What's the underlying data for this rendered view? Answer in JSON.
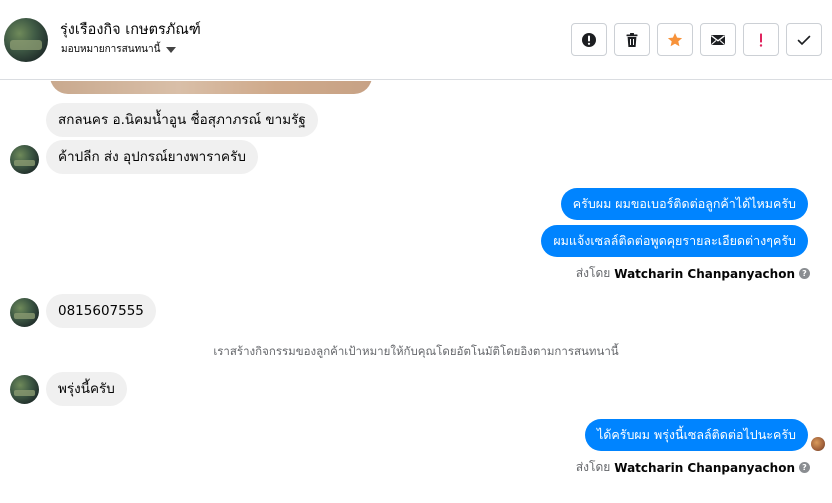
{
  "header": {
    "contact_name": "รุ่งเรืองกิจ เกษตรภัณฑ์",
    "assign_label": "มอบหมายการสนทนานี้",
    "toolbar": [
      {
        "name": "spam-button",
        "icon": "alert-circle-icon"
      },
      {
        "name": "delete-button",
        "icon": "trash-icon"
      },
      {
        "name": "star-button",
        "icon": "star-icon"
      },
      {
        "name": "mark-unread-button",
        "icon": "envelope-icon"
      },
      {
        "name": "flag-button",
        "icon": "exclamation-icon"
      },
      {
        "name": "mark-done-button",
        "icon": "checkmark-icon"
      }
    ],
    "colors": {
      "star": "#f7923a",
      "flag": "#e0245e",
      "icon": "#1c1e21"
    }
  },
  "messages": {
    "in1": "สกลนคร อ.นิคมน้ำอูน ชื่อสุภาภรณ์  ขามรัฐ",
    "in2": "ค้าปลีก ส่ง อุปกรณ์ยางพาราครับ",
    "out1": "ครับผม ผมขอเบอร์ติดต่อลูกค้าได้ไหมครับ",
    "out2": "ผมแจ้งเซลล์ติดต่อพูดคุยรายละเอียดต่างๆครับ",
    "sent1_prefix": "ส่งโดย",
    "sent1_name": "Watcharin Chanpanyachon",
    "in3": "0815607555",
    "system_note": "เราสร้างกิจกรรมของลูกค้าเป้าหมายให้กับคุณโดยอัตโนมัติโดยอิงตามการสนทนานี้",
    "in4": "พรุ่งนี้ครับ",
    "out3": "ได้ครับผม พรุ่งนี้เซลล์ติดต่อไปนะครับ",
    "sent2_prefix": "ส่งโดย",
    "sent2_name": "Watcharin Chanpanyachon"
  },
  "colors": {
    "outgoing_bubble": "#0084ff",
    "incoming_bubble": "#f0f0f0",
    "meta_text": "#65676b"
  }
}
